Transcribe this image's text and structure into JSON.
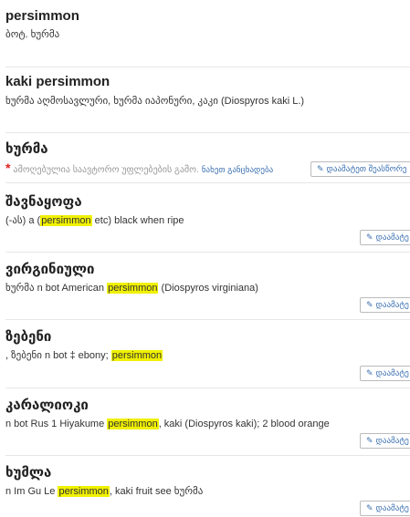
{
  "entries": [
    {
      "title": "persimmon",
      "desc": "ბოტ. ხურმა"
    },
    {
      "title": "kaki persimmon",
      "desc": "ხურმა აღმოსავლური, ხურმა იაპონური, კაკი (Diospyros kaki L.)"
    },
    {
      "title": "ხურმა",
      "locked_text": "ამოღებულია საავტორო უფლებების გამო.",
      "details_link": "ნახეთ განცხადება",
      "button_label": "დაამატეთ შეასწორე"
    },
    {
      "title": "შავნაყოფა",
      "desc_pre": "(-ას) a (",
      "desc_hl": "persimmon",
      "desc_post": " etc) black when ripe",
      "button_label": "დაამატე"
    },
    {
      "title": "ვირგინიული",
      "desc_pre": "ხურმა n bot American ",
      "desc_hl": "persimmon",
      "desc_post": " (Diospyros virginiana)",
      "button_label": "დაამატე"
    },
    {
      "title": "ზებენი",
      "desc_pre": ", ზებენი n bot ‡ ebony; ",
      "desc_hl": "persimmon",
      "desc_post": "",
      "button_label": "დაამატე"
    },
    {
      "title": "კარალიოკი",
      "desc_pre": "n bot Rus 1 Hiyakume ",
      "desc_hl": "persimmon",
      "desc_post": ", kaki (Diospyros kaki); 2 blood orange",
      "button_label": "დაამატე"
    },
    {
      "title": "ხუმლა",
      "desc_pre": "n Im Gu Le ",
      "desc_hl": "persimmon",
      "desc_post": ", kaki fruit see ხურმა",
      "button_label": "დაამატე"
    }
  ],
  "colors": {
    "highlight": "#f0f000",
    "link": "#3a6fb0",
    "required_star": "#e02020"
  },
  "icons": {
    "edit": "pencil-square-icon",
    "required": "asterisk-icon"
  }
}
